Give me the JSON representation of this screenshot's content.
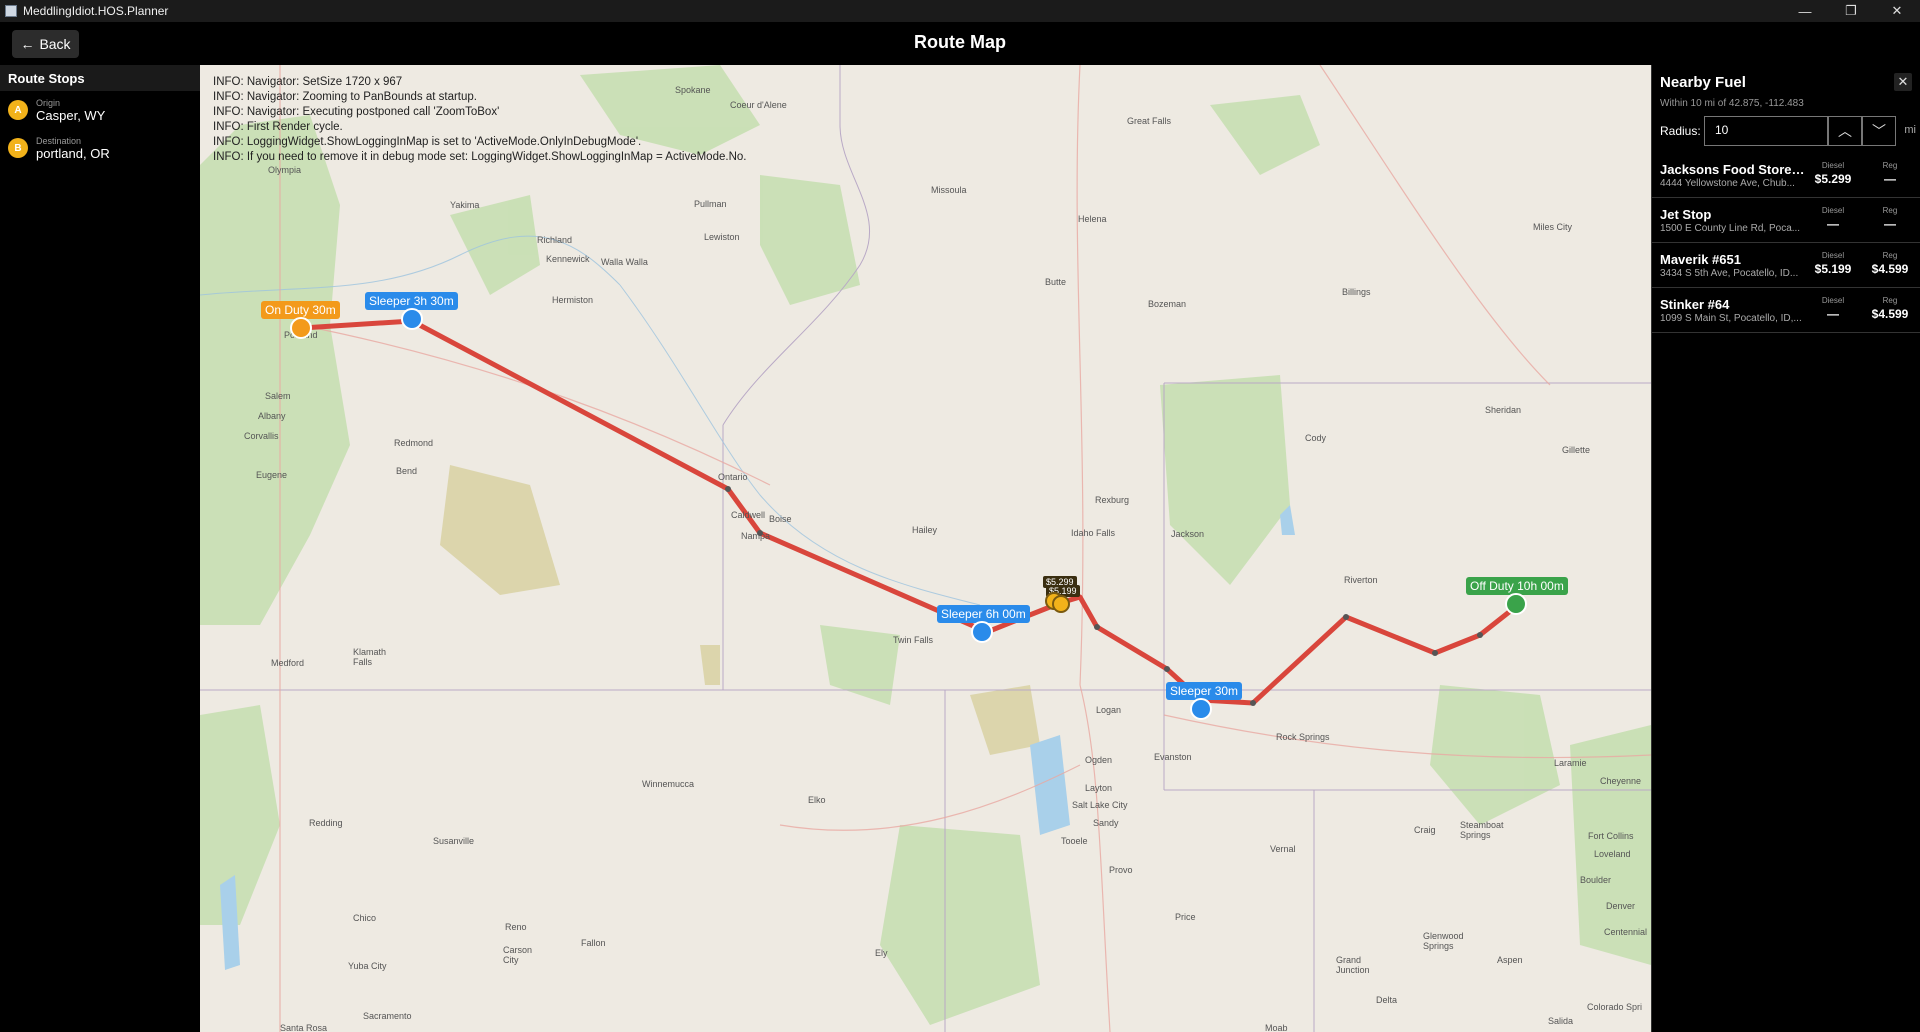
{
  "window": {
    "title": "MeddlingIdiot.HOS.Planner",
    "controls": [
      "—",
      "❐",
      "✕"
    ]
  },
  "header": {
    "back_label": "Back",
    "back_icon": "←",
    "title": "Route Map"
  },
  "sidebar": {
    "title": "Route Stops",
    "stops": [
      {
        "badge": "A",
        "label": "Origin",
        "value": "Casper, WY"
      },
      {
        "badge": "B",
        "label": "Destination",
        "value": "portland, OR"
      }
    ]
  },
  "map": {
    "log_lines": [
      "INFO: Navigator: SetSize 1720 x 967",
      "INFO: Navigator: Zooming to PanBounds at startup.",
      "INFO: Navigator: Executing postponed call 'ZoomToBox'",
      "INFO: First Render cycle.",
      "INFO: LoggingWidget.ShowLoggingInMap is set to 'ActiveMode.OnlyInDebugMode'.",
      "INFO: If you need to remove it in debug mode set: LoggingWidget.ShowLoggingInMap = ActiveMode.No."
    ],
    "markers": [
      {
        "label": "On Duty  30m",
        "color": "#f39a1b"
      },
      {
        "label": "Sleeper  3h 30m",
        "color": "#2a8bea"
      },
      {
        "label": "Sleeper  6h 00m",
        "color": "#2a8bea"
      },
      {
        "label": "Sleeper  30m",
        "color": "#2a8bea"
      },
      {
        "label": "Off Duty  10h 00m",
        "color": "#3aa34a"
      }
    ],
    "price_tags": [
      "$5.299",
      "$5.199"
    ],
    "places": {
      "spokane": "Spokane",
      "coeur": "Coeur\nd'Alene",
      "great_falls": "Great Falls",
      "olympia": "Olympia",
      "missoula": "Missoula",
      "helena": "Helena",
      "miles_city": "Miles City",
      "pullman": "Pullman",
      "yakima": "Yakima",
      "lewiston": "Lewiston",
      "richland": "Richland",
      "kennewick": "Kennewick",
      "walla_walla": "Walla Walla",
      "butte": "Butte",
      "hermiston": "Hermiston",
      "bozeman": "Bozeman",
      "billings": "Billings",
      "portland": "Portland",
      "salem": "Salem",
      "albany": "Albany",
      "corvallis": "Corvallis",
      "sheridan": "Sheridan",
      "redmond": "Redmond",
      "bend": "Bend",
      "cody": "Cody",
      "eugene": "Eugene",
      "gillette": "Gillette",
      "ontario": "Ontario",
      "caldwell": "Caldwell",
      "boise": "Boise",
      "nampa": "Nampa",
      "rexburg": "Rexburg",
      "hailey": "Hailey",
      "idaho_falls": "Idaho Falls",
      "jackson": "Jackson",
      "riverton": "Riverton",
      "twin_falls": "Twin Falls",
      "medford": "Medford",
      "klamath": "Klamath\nFalls",
      "logan": "Logan",
      "rock_springs": "Rock Springs",
      "evanston": "Evanston",
      "ogden": "Ogden",
      "laramie": "Laramie",
      "cheyenne": "Cheyenne",
      "winnemucca": "Winnemucca",
      "elko": "Elko",
      "layton": "Layton",
      "salt_lake": "Salt Lake City",
      "redding": "Redding",
      "sandy": "Sandy",
      "craig": "Craig",
      "steamboat": "Steamboat\nSprings",
      "fort_collins": "Fort Collins",
      "loveland": "Loveland",
      "susanville": "Susanville",
      "tooele": "Tooele",
      "provo": "Provo",
      "vernal": "Vernal",
      "boulder": "Boulder",
      "chico": "Chico",
      "reno": "Reno",
      "price": "Price",
      "denver": "Denver",
      "centennial": "Centennial",
      "fallon": "Fallon",
      "carson": "Carson\nCity",
      "ely": "Ely",
      "glenwood": "Glenwood\nSprings",
      "aspen": "Aspen",
      "grand_junction": "Grand\nJunction",
      "yuba": "Yuba City",
      "sacramento": "Sacramento",
      "delta": "Delta",
      "colorado_springs": "Colorado Spri",
      "santa_rosa": "Santa Rosa",
      "moab": "Moab",
      "salida": "Salida"
    }
  },
  "fuel": {
    "title": "Nearby Fuel",
    "close_icon": "✕",
    "subtitle": "Within 10 mi of 42.875, -112.483",
    "radius_label": "Radius:",
    "radius_value": "10",
    "unit": "mi",
    "up_icon": "︿",
    "down_icon": "﹀",
    "diesel_header": "Diesel",
    "reg_header": "Reg",
    "stations": [
      {
        "name": "Jacksons Food Stores ...",
        "address": "4444 Yellowstone Ave, Chub...",
        "diesel": "$5.299",
        "reg": "—"
      },
      {
        "name": "Jet Stop",
        "address": "1500 E County Line Rd, Poca...",
        "diesel": "—",
        "reg": "—"
      },
      {
        "name": "Maverik #651",
        "address": "3434 S 5th Ave, Pocatello, ID...",
        "diesel": "$5.199",
        "reg": "$4.599"
      },
      {
        "name": "Stinker #64",
        "address": "1099 S Main St, Pocatello, ID,...",
        "diesel": "—",
        "reg": "$4.599"
      }
    ]
  }
}
